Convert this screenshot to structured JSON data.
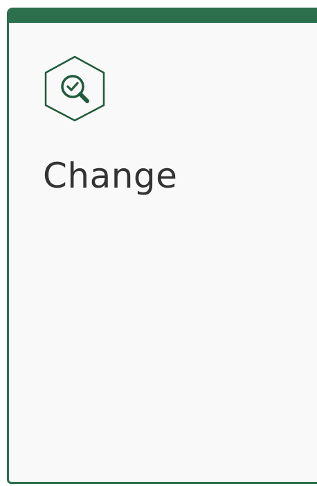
{
  "card": {
    "title": "Change",
    "icon": "hexagon-magnifier-check-icon",
    "colors": {
      "accent": "#2b6f4c",
      "icon_stroke": "#1f5a3c",
      "background": "#f9f9f9",
      "title_text": "#333333"
    }
  }
}
